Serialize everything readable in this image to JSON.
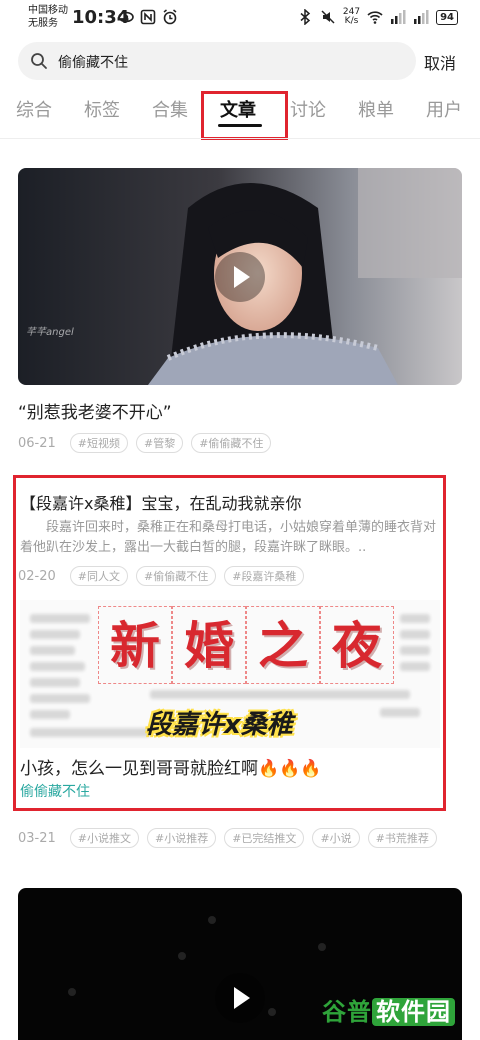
{
  "status_bar": {
    "carrier_line1": "中国移动",
    "carrier_line2": "无服务",
    "time": "10:34",
    "net_speed_value": "247",
    "net_speed_unit": "K/s",
    "battery": "94"
  },
  "search": {
    "query": "偷偷藏不住",
    "cancel_label": "取消"
  },
  "tabs": [
    {
      "label": "综合"
    },
    {
      "label": "标签"
    },
    {
      "label": "合集"
    },
    {
      "label": "文章",
      "active": true
    },
    {
      "label": "讨论"
    },
    {
      "label": "粮单"
    },
    {
      "label": "用户"
    }
  ],
  "results": [
    {
      "type": "video",
      "title": "“别惹我老婆不开心”",
      "date": "06-21",
      "tags": [
        "#短视频",
        "#管黎",
        "#偷偷藏不住"
      ],
      "watermark": "芊芊angel"
    },
    {
      "type": "article",
      "title": "【段嘉许x桑稚】宝宝，在乱动我就亲你",
      "excerpt": "段嘉许回来时，桑稚正在和桑母打电话，小姑娘穿着单薄的睡衣背对着他趴在沙发上，露出一大截白皙的腿，段嘉许眯了眯眼。..",
      "date": "02-20",
      "tags": [
        "#同人文",
        "#偷偷藏不住",
        "#段嘉许桑稚"
      ]
    },
    {
      "type": "article-image",
      "image_title_chars": [
        "新",
        "婚",
        "之",
        "夜"
      ],
      "image_names": "段嘉许x桑稚",
      "subtitle": "小孩，怎么一见到哥哥就脸红啊🔥🔥🔥",
      "source": "偷偷藏不住",
      "date": "03-21",
      "tags": [
        "#小说推文",
        "#小说推荐",
        "#已完结推文",
        "#小说",
        "#书荒推荐"
      ]
    }
  ],
  "watermark_brand": {
    "part1": "谷普",
    "part2": "软件园"
  },
  "colors": {
    "highlight_box": "#e0242f",
    "source_link": "#2aa8a0",
    "brand_green": "#2fa43a"
  }
}
